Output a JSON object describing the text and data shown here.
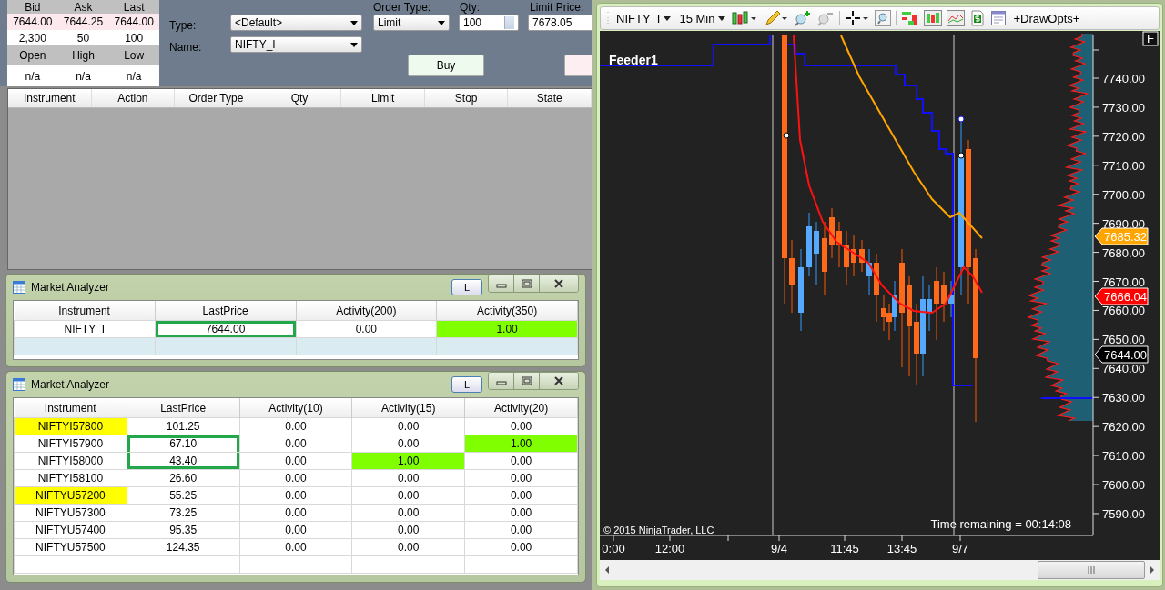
{
  "quote": {
    "columns": [
      "Bid",
      "Ask",
      "Last"
    ],
    "rows": [
      [
        "7644.00",
        "7644.25",
        "7644.00"
      ],
      [
        "2,300",
        "50",
        "100"
      ]
    ],
    "columns_2": [
      "Open",
      "High",
      "Low"
    ],
    "rows_2": [
      [
        "n/a",
        "n/a",
        "n/a"
      ]
    ]
  },
  "order_entry": {
    "type_label": "Type:",
    "type_value": "<Default>",
    "name_label": "Name:",
    "name_value": "NIFTY_I",
    "order_type_label": "Order Type:",
    "order_type_value": "Limit",
    "qty_label": "Qty:",
    "qty_value": "100",
    "limit_price_label": "Limit Price:",
    "limit_price_value": "7678.05",
    "buy_button": "Buy"
  },
  "orders_table": {
    "columns": [
      "Instrument",
      "Action",
      "Order Type",
      "Qty",
      "Limit",
      "Stop",
      "State"
    ]
  },
  "analyzers": [
    {
      "title": "Market Analyzer",
      "l_button": "L",
      "blank_row_selected": true,
      "columns": [
        "Instrument",
        "LastPrice",
        "Activity(200)",
        "Activity(350)"
      ],
      "rows": [
        [
          {
            "text": "NIFTY_I"
          },
          {
            "text": "7644.00",
            "outlined": true
          },
          {
            "text": "0.00"
          },
          {
            "text": "1.00",
            "color": "#80ff00"
          }
        ]
      ]
    },
    {
      "title": "Market Analyzer",
      "l_button": "L",
      "blank_row_selected": false,
      "columns": [
        "Instrument",
        "LastPrice",
        "Activity(10)",
        "Activity(15)",
        "Activity(20)"
      ],
      "rows": [
        [
          {
            "text": "NIFTYI57800",
            "color": "#ffff00"
          },
          {
            "text": "101.25"
          },
          {
            "text": "0.00"
          },
          {
            "text": "0.00"
          },
          {
            "text": "0.00"
          }
        ],
        [
          {
            "text": "NIFTYI57900"
          },
          {
            "text": "67.10",
            "outlined": true
          },
          {
            "text": "0.00"
          },
          {
            "text": "0.00"
          },
          {
            "text": "1.00",
            "color": "#80ff00"
          }
        ],
        [
          {
            "text": "NIFTYI58000"
          },
          {
            "text": "43.40",
            "outlined": true
          },
          {
            "text": "0.00"
          },
          {
            "text": "1.00",
            "color": "#80ff00"
          },
          {
            "text": "0.00"
          }
        ],
        [
          {
            "text": "NIFTYI58100"
          },
          {
            "text": "26.60"
          },
          {
            "text": "0.00"
          },
          {
            "text": "0.00"
          },
          {
            "text": "0.00"
          }
        ],
        [
          {
            "text": "NIFTYU57200",
            "color": "#ffff00"
          },
          {
            "text": "55.25"
          },
          {
            "text": "0.00"
          },
          {
            "text": "0.00"
          },
          {
            "text": "0.00"
          }
        ],
        [
          {
            "text": "NIFTYU57300"
          },
          {
            "text": "73.25"
          },
          {
            "text": "0.00"
          },
          {
            "text": "0.00"
          },
          {
            "text": "0.00"
          }
        ],
        [
          {
            "text": "NIFTYU57400"
          },
          {
            "text": "95.35"
          },
          {
            "text": "0.00"
          },
          {
            "text": "0.00"
          },
          {
            "text": "0.00"
          }
        ],
        [
          {
            "text": "NIFTYU57500"
          },
          {
            "text": "124.35"
          },
          {
            "text": "0.00"
          },
          {
            "text": "0.00"
          },
          {
            "text": "0.00"
          }
        ]
      ]
    }
  ],
  "chart": {
    "instrument": "NIFTY_I",
    "interval": "15 Min",
    "draw_opts": "+DrawOpts+",
    "label": "Feeder1",
    "f_button": "F",
    "price_labels": [
      "7740.00",
      "7730.00",
      "7720.00",
      "7710.00",
      "7700.00",
      "7690.00",
      "7680.00",
      "7670.00",
      "7660.00",
      "7650.00",
      "7640.00",
      "7630.00",
      "7620.00",
      "7610.00",
      "7600.00",
      "7590.00"
    ],
    "markers": [
      {
        "text": "7685.32",
        "color": "#ffa500"
      },
      {
        "text": "7666.04",
        "color": "#ff0000"
      },
      {
        "text": "7644.00",
        "color": "#000000"
      }
    ],
    "time_labels": [
      "0:00",
      "12:00",
      "9/4",
      "11:45",
      "13:45",
      "9/7"
    ],
    "copyright": "© 2015 NinjaTrader, LLC",
    "time_remaining": "Time remaining = 00:14:08"
  }
}
